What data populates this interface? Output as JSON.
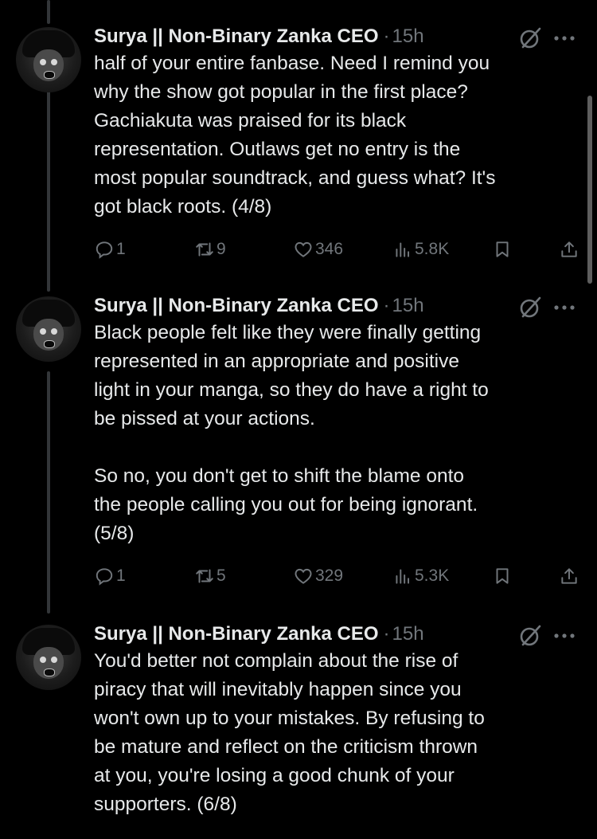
{
  "tweets": [
    {
      "author": "Surya || Non-Binary Zanka CEO",
      "separator": "·",
      "time": "15h",
      "text": "half of your entire fanbase. Need I remind you\nwhy the show got popular in the first place?\nGachiakuta was praised for its black\nrepresentation. Outlaws get no entry is the\nmost popular soundtrack, and guess what? It's\ngot black roots. (4/8)",
      "replies": "1",
      "reposts": "9",
      "likes": "346",
      "views": "5.8K"
    },
    {
      "author": "Surya || Non-Binary Zanka CEO",
      "separator": "·",
      "time": "15h",
      "text": "Black people felt like they were finally getting\nrepresented in an appropriate and positive\nlight in your manga, so they do have a right to\nbe pissed at your actions.\n\nSo no, you don't get to shift the blame onto\nthe people calling you out for being ignorant.\n(5/8)",
      "replies": "1",
      "reposts": "5",
      "likes": "329",
      "views": "5.3K"
    },
    {
      "author": "Surya || Non-Binary Zanka CEO",
      "separator": "·",
      "time": "15h",
      "text": "You'd better not complain about the rise of\npiracy that will inevitably happen since you\nwon't own up to your mistakes. By refusing to\nbe mature and reflect on the criticism thrown\nat you, you're losing a good chunk of your\nsupporters. (6/8)"
    }
  ],
  "icons": {
    "reply": "reply-icon",
    "repost": "repost-icon",
    "like": "heart-icon",
    "views": "views-chart-icon",
    "bookmark": "bookmark-icon",
    "share": "share-icon",
    "grok": "grok-icon",
    "more": "more-icon"
  },
  "colors": {
    "background": "#000000",
    "text": "#e7e9ea",
    "muted": "#71767b",
    "thread_line": "#333639"
  }
}
